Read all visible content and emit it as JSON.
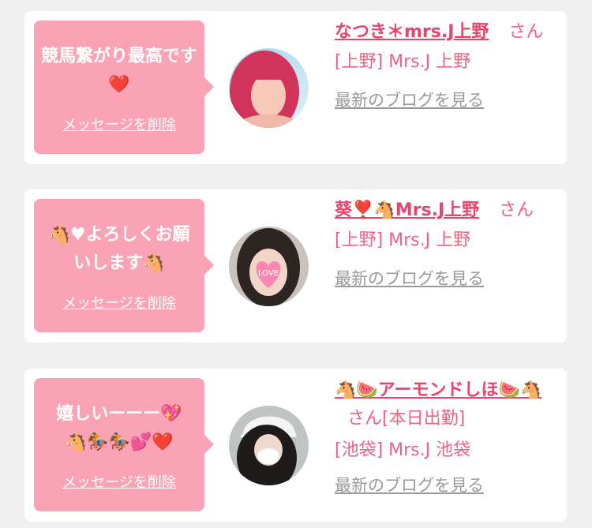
{
  "colors": {
    "background": "#f0f0f0",
    "bubble": "#f9a3b4",
    "name_pink": "#e8456c",
    "text_pink": "#f06283",
    "link_gray": "#9a9a9a"
  },
  "cards": [
    {
      "message": "競馬繋がり最高です❤️",
      "delete_label": "メッセージを削除",
      "name": "なつき＊mrs.J上野",
      "suffix": "さん",
      "shop": "[上野] Mrs.J 上野",
      "blog_label": "最新のブログを見る",
      "avatar_icon": "avatar-red-hair-photo"
    },
    {
      "message": "🐴♥よろしくお願いします🐴",
      "delete_label": "メッセージを削除",
      "name": "葵❣️🐴Mrs.J上野",
      "suffix": "さん",
      "shop": "[上野] Mrs.J 上野",
      "blog_label": "最新のブログを見る",
      "avatar_icon": "avatar-heart-face-photo"
    },
    {
      "message": "嬉しいーーー💖\n🐴🏇🏇💕❤️",
      "delete_label": "メッセージを削除",
      "name": "🐴🍉アーモンドしほ🍉🐴",
      "suffix": "さん[本日出勤]",
      "shop": "[池袋] Mrs.J 池袋",
      "blog_label": "最新のブログを見る",
      "avatar_icon": "avatar-masked-cap-photo"
    }
  ]
}
